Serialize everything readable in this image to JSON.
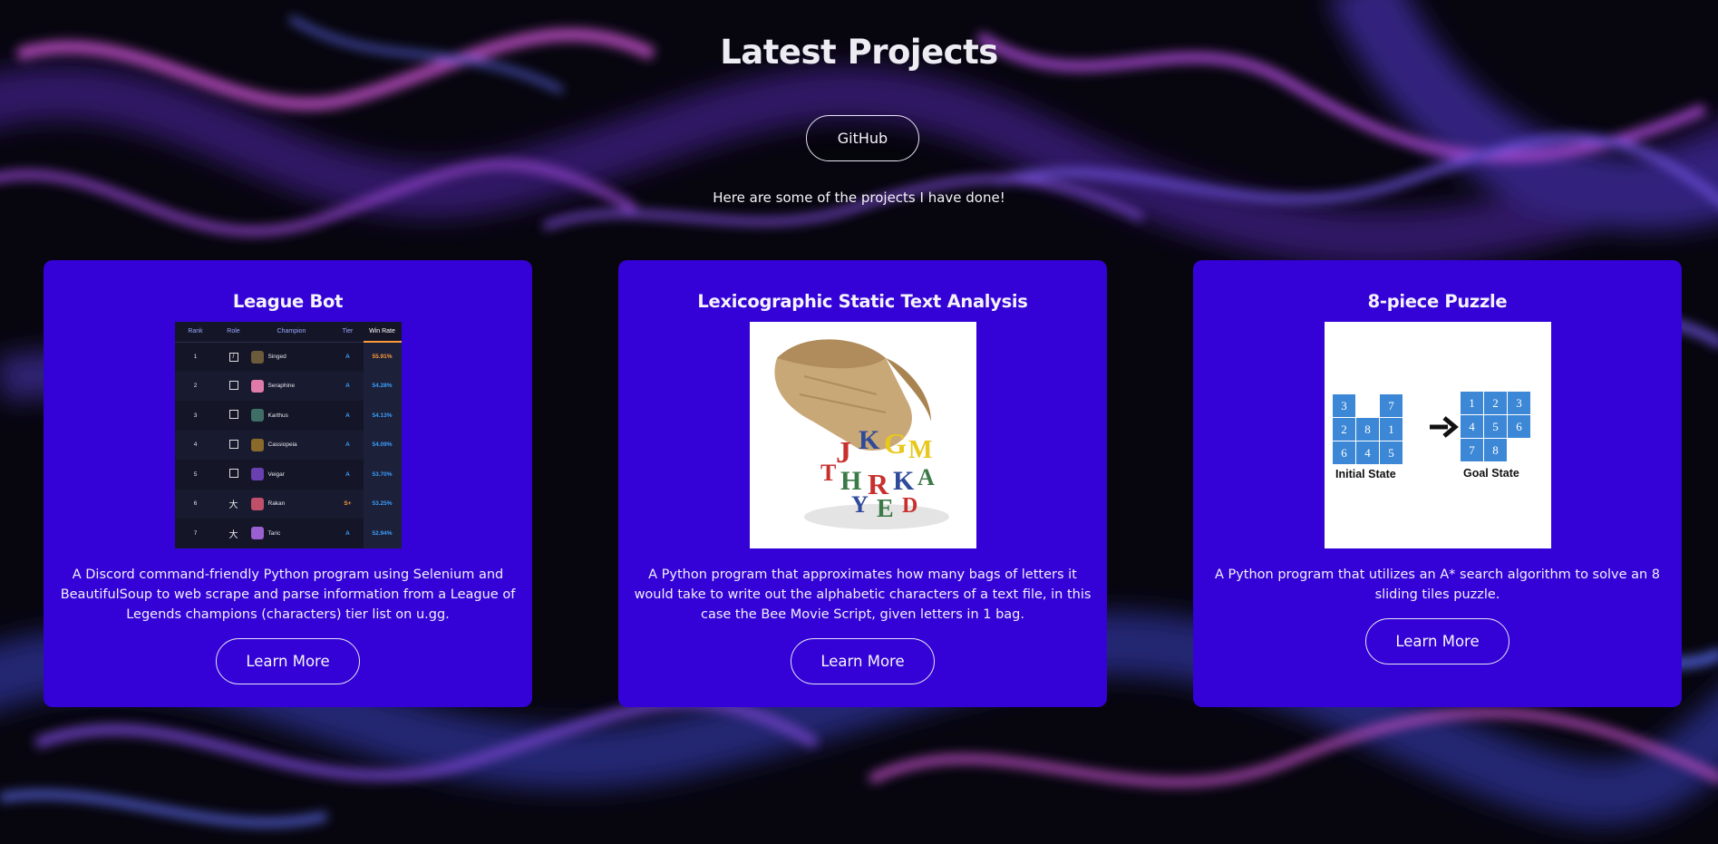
{
  "page": {
    "title": "Latest Projects",
    "github_label": "GitHub",
    "subtitle": "Here are some of the projects I have done!"
  },
  "projects": [
    {
      "title": "League Bot",
      "description": "A Discord command-friendly Python program using Selenium and BeautifulSoup to web scrape and parse information from a League of Legends champions (characters) tier list on u.gg.",
      "button_label": "Learn More",
      "image": {
        "headers": [
          "Rank",
          "Role",
          "Champion",
          "Tier",
          "Win Rate"
        ],
        "rows": [
          {
            "rank": "1",
            "champion": "Singed",
            "tier": "A",
            "win_rate": "55.91%"
          },
          {
            "rank": "2",
            "champion": "Seraphine",
            "tier": "A",
            "win_rate": "54.28%"
          },
          {
            "rank": "3",
            "champion": "Karthus",
            "tier": "A",
            "win_rate": "54.13%"
          },
          {
            "rank": "4",
            "champion": "Cassiopeia",
            "tier": "A",
            "win_rate": "54.09%"
          },
          {
            "rank": "5",
            "champion": "Veigar",
            "tier": "A",
            "win_rate": "53.70%"
          },
          {
            "rank": "6",
            "champion": "Rakan",
            "tier": "S+",
            "win_rate": "53.25%"
          },
          {
            "rank": "7",
            "champion": "Taric",
            "tier": "A",
            "win_rate": "52.94%"
          }
        ]
      }
    },
    {
      "title": "Lexicographic Static Text Analysis",
      "description": "A Python program that approximates how many bags of letters it would take to write out the alphabetic characters of a text file, in this case the Bee Movie Script, given letters in 1 bag.",
      "button_label": "Learn More"
    },
    {
      "title": "8-piece Puzzle",
      "description": "A Python program that utilizes an A* search algorithm to solve an 8 sliding tiles puzzle.",
      "button_label": "Learn More",
      "image": {
        "initial_label": "Initial State",
        "goal_label": "Goal State",
        "initial_tiles": [
          "3",
          "",
          "7",
          "2",
          "8",
          "1",
          "6",
          "4",
          "5"
        ],
        "goal_tiles": [
          "1",
          "2",
          "3",
          "4",
          "5",
          "6",
          "7",
          "8",
          ""
        ]
      }
    }
  ],
  "colors": {
    "card_bg": "#3402d6",
    "page_bg": "#07060f",
    "tile_blue": "#3c87d6"
  }
}
